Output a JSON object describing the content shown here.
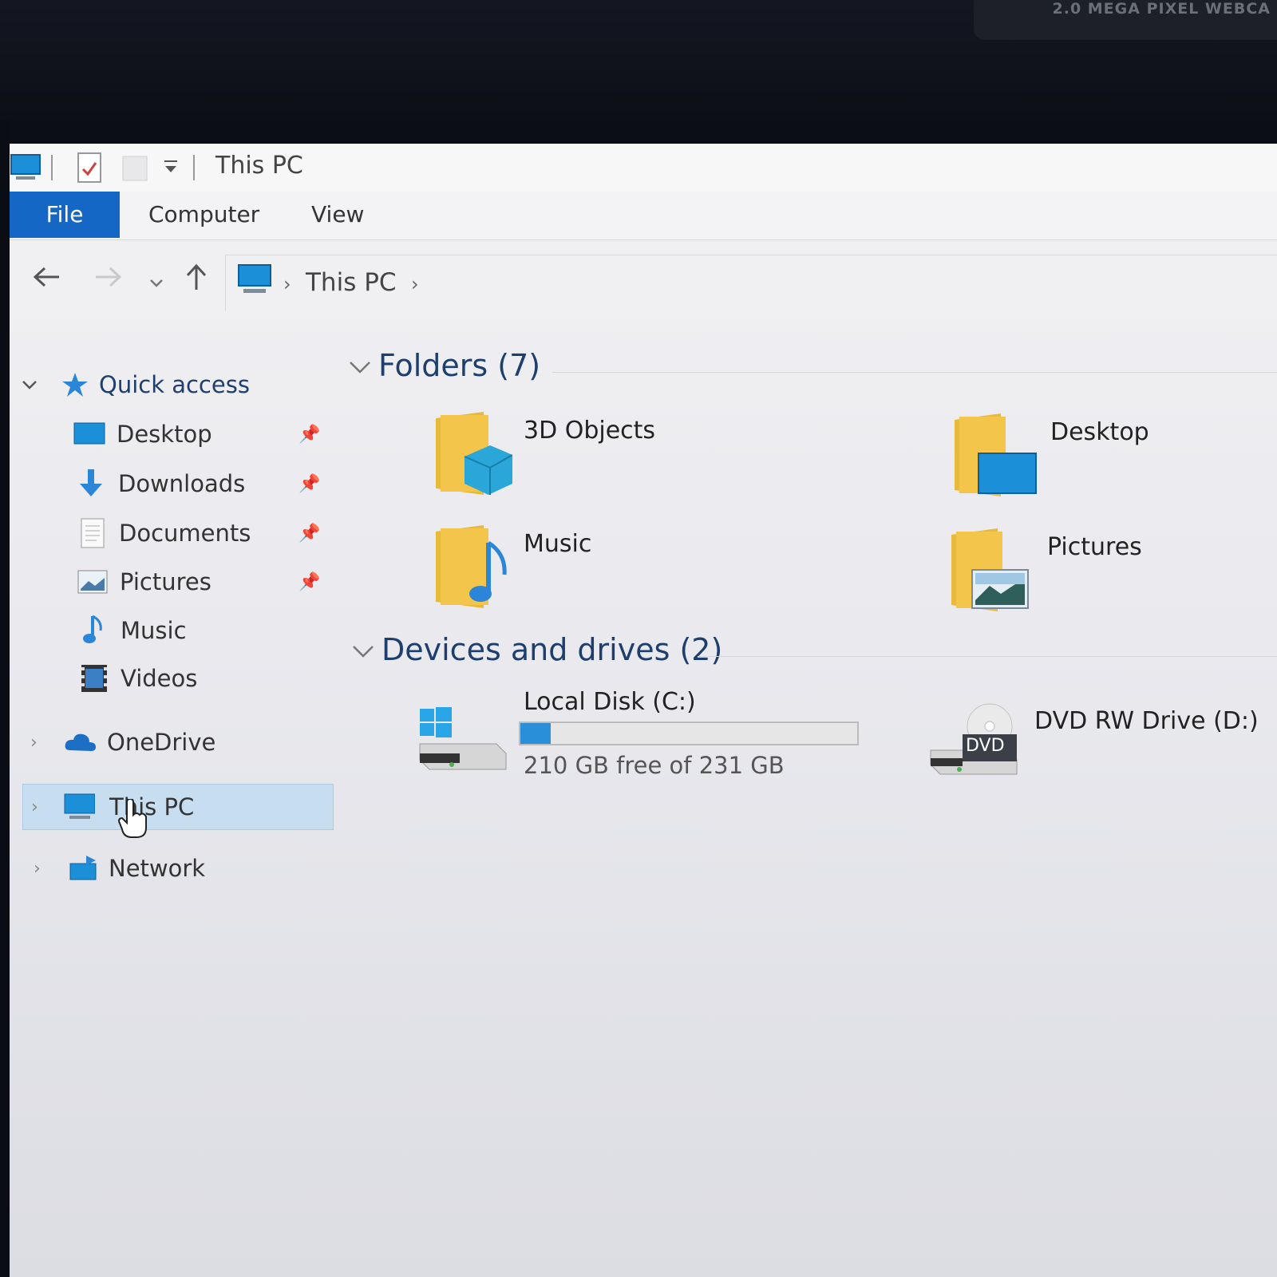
{
  "bezel": {
    "webcam_text": "2.0 MEGA PIXEL WEBCA"
  },
  "window": {
    "title": "This PC"
  },
  "ribbon": {
    "tabs": [
      "File",
      "Computer",
      "View"
    ]
  },
  "address": {
    "path": "This PC"
  },
  "nav_pane": {
    "quick_access": "Quick access",
    "pinned": [
      {
        "label": "Desktop",
        "icon": "desktop-icon"
      },
      {
        "label": "Downloads",
        "icon": "download-arrow-icon"
      },
      {
        "label": "Documents",
        "icon": "document-icon"
      },
      {
        "label": "Pictures",
        "icon": "pictures-icon"
      }
    ],
    "unpinned": [
      {
        "label": "Music",
        "icon": "music-note-icon"
      },
      {
        "label": "Videos",
        "icon": "film-icon"
      }
    ],
    "onedrive": "OneDrive",
    "this_pc": "This PC",
    "network": "Network"
  },
  "content": {
    "folders_header": "Folders (7)",
    "folders": [
      {
        "label": "3D Objects",
        "icon": "3d-objects-folder-icon"
      },
      {
        "label": "Desktop",
        "icon": "desktop-folder-icon"
      },
      {
        "label": "Music",
        "icon": "music-folder-icon"
      },
      {
        "label": "Pictures",
        "icon": "pictures-folder-icon"
      }
    ],
    "devices_header": "Devices and drives (2)",
    "drives": [
      {
        "label": "Local Disk (C:)",
        "subtitle": "210 GB free of 231 GB",
        "used_fraction": 0.09
      },
      {
        "label": "DVD RW Drive (D:)",
        "badge": "DVD"
      }
    ]
  },
  "colors": {
    "accent": "#1567c6",
    "folder": "#f3c54a",
    "selection": "#c7def0",
    "progress": "#2a8fd9"
  }
}
